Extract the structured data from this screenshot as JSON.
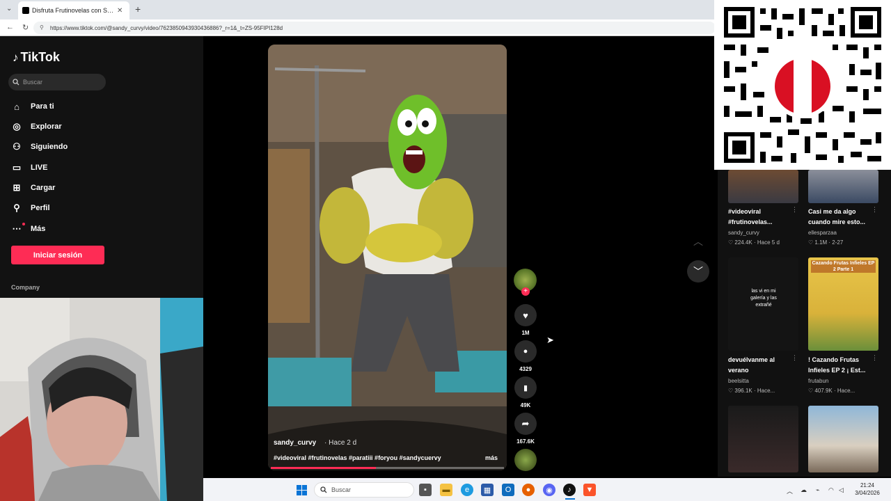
{
  "browser": {
    "tab_title": "Disfruta Frutinovelas con Sandy C",
    "url": "https://www.tiktok.com/@sandy_curvy/video/7623850943930436886?_r=1&_t=ZS-95FIPI128d",
    "new_tab": "+"
  },
  "sidebar": {
    "logo": "TikTok",
    "search_placeholder": "Buscar",
    "items": [
      {
        "label": "Para ti",
        "icon": "home-icon"
      },
      {
        "label": "Explorar",
        "icon": "compass-icon"
      },
      {
        "label": "Siguiendo",
        "icon": "following-icon"
      },
      {
        "label": "LIVE",
        "icon": "live-icon"
      },
      {
        "label": "Cargar",
        "icon": "upload-icon"
      },
      {
        "label": "Perfil",
        "icon": "profile-icon"
      },
      {
        "label": "Más",
        "icon": "more-icon"
      }
    ],
    "login": "Iniciar sesión",
    "company": "Company"
  },
  "video": {
    "username": "sandy_curvy",
    "time": "· Hace 2 d",
    "description": "#videoviral #frutinovelas #paratiii #foryou #sandycuervy",
    "more": "más",
    "progress": 0.45
  },
  "actions": {
    "likes": "1M",
    "comments": "4329",
    "saves": "49K",
    "shares": "167.6K"
  },
  "related": [
    {
      "title": "#videoviral #frutinovelas...",
      "user": "sandy_curvy",
      "meta": "224.4K · Hace 5 d",
      "overlay": ""
    },
    {
      "title": "Casi me da algo cuando mire esto...",
      "user": "ellesparzaa",
      "meta": "1.1M · 2-27",
      "overlay": ""
    },
    {
      "title": "devuélvanme al verano",
      "user": "beelsitta",
      "meta": "396.1K · Hace...",
      "overlay": "las vi en mi galería y las extrañé"
    },
    {
      "title": "! Cazando Frutas Infieles EP 2 ¡ Est...",
      "user": "frutabun",
      "meta": "407.9K · Hace...",
      "overlay": "Cazando Frutas Infieles EP 2 Parte 1"
    },
    {
      "title": "",
      "user": "",
      "meta": "",
      "overlay": ""
    },
    {
      "title": "",
      "user": "",
      "meta": "",
      "overlay": ""
    }
  ],
  "taskbar": {
    "search": "Buscar",
    "time": "21:24",
    "date": "3/04/2026"
  },
  "colors": {
    "accent": "#fe2c55",
    "sidebar": "#121212",
    "background": "#000000"
  }
}
